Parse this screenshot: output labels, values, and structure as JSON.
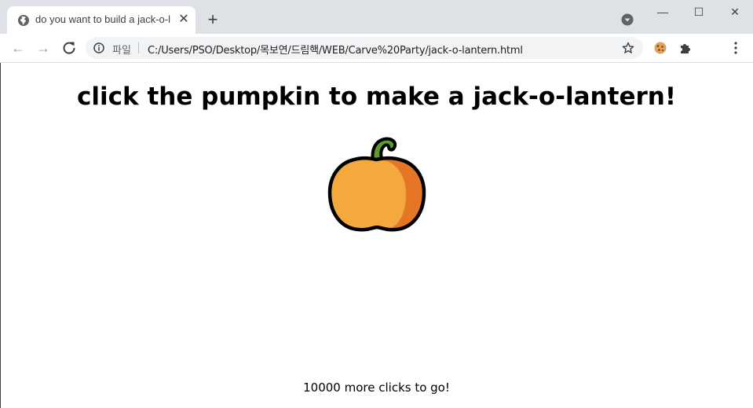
{
  "browser": {
    "tab": {
      "title": "do you want to build a jack-o-l",
      "favicon": "globe-icon"
    },
    "window_controls": {
      "minimize": "—",
      "maximize": "☐",
      "close": "✕"
    },
    "new_tab_symbol": "+",
    "tab_close_symbol": "✕",
    "omnibox": {
      "scheme_label": "파일",
      "url": "C:/Users/PSO/Desktop/목보연/드림핵/WEB/Carve%20Party/jack-o-lantern.html"
    },
    "nav": {
      "back": "←",
      "forward": "→"
    }
  },
  "page": {
    "heading": "click the pumpkin to make a jack-o-lantern!",
    "counter": {
      "count": "10000",
      "suffix": " more clicks to go!"
    }
  },
  "colors": {
    "pumpkin_body": "#f4a93f",
    "pumpkin_shade": "#e57625",
    "stem": "#5c9b2c",
    "outline": "#000000"
  }
}
